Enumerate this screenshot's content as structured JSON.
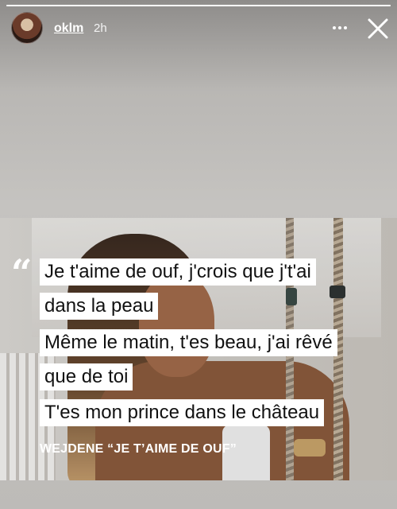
{
  "story": {
    "progress_fraction": 1.0,
    "user": {
      "username": "oklm",
      "time_ago": "2h"
    },
    "icons": {
      "more": "more-horizontal-icon",
      "close": "close-icon"
    }
  },
  "quote": {
    "mark": "“",
    "lines": [
      "Je t'aime de ouf, j'crois que j't'ai",
      "dans la peau",
      "Même le matin, t'es beau, j'ai rêvé",
      "que de toi",
      "T'es mon prince dans le château"
    ],
    "credit": "WEJDENE “JE T’AIME DE OUF”"
  },
  "colors": {
    "background": "#c5c3c0",
    "text_highlight": "#ffffff",
    "text": "#111111"
  }
}
